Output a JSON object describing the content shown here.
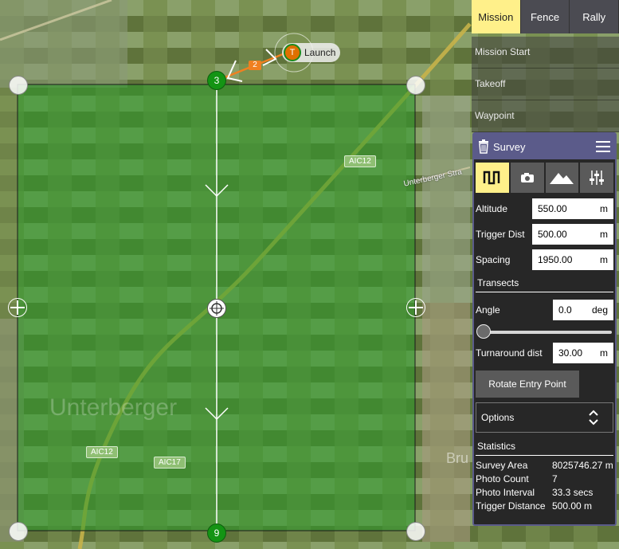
{
  "tabs": [
    {
      "label": "Mission",
      "active": true
    },
    {
      "label": "Fence",
      "active": false
    },
    {
      "label": "Rally",
      "active": false
    }
  ],
  "mission_items": [
    "Mission Start",
    "Takeoff",
    "Waypoint"
  ],
  "survey": {
    "title": "Survey",
    "modes": [
      "transect-icon",
      "camera-icon",
      "terrain-icon",
      "sliders-icon"
    ],
    "fields": {
      "altitude": {
        "label": "Altitude",
        "value": "550.00",
        "unit": "m"
      },
      "trigger_dist": {
        "label": "Trigger Dist",
        "value": "500.00",
        "unit": "m"
      },
      "spacing": {
        "label": "Spacing",
        "value": "1950.00",
        "unit": "m"
      }
    },
    "transects": {
      "title": "Transects",
      "angle": {
        "label": "Angle",
        "value": "0.0",
        "unit": "deg"
      },
      "angle_slider_fraction": 0,
      "turnaround": {
        "label": "Turnaround dist",
        "value": "30.00",
        "unit": "m"
      },
      "rotate_button": "Rotate Entry Point",
      "options_label": "Options"
    },
    "statistics": {
      "title": "Statistics",
      "rows": [
        {
          "label": "Survey Area",
          "value": "8025746.27 m"
        },
        {
          "label": "Photo Count",
          "value": "7"
        },
        {
          "label": "Photo Interval",
          "value": "33.3 secs"
        },
        {
          "label": "Trigger Distance",
          "value": "500.00 m"
        }
      ]
    }
  },
  "map": {
    "launch_label": "Launch",
    "launch_letter": "T",
    "waypoint_top": "3",
    "waypoint_bottom": "9",
    "leg_label": "2",
    "road_labels": [
      "AIC12",
      "AIC12",
      "AIC17"
    ],
    "street_text": "Unterberger Stra",
    "town_text": "Unterberger",
    "edge_text": "Bru",
    "colors": {
      "survey_fill": "#2a9a2a",
      "path": "#f08020",
      "panel_accent": "#5b5b8a",
      "active_tab": "#fff08a"
    }
  }
}
